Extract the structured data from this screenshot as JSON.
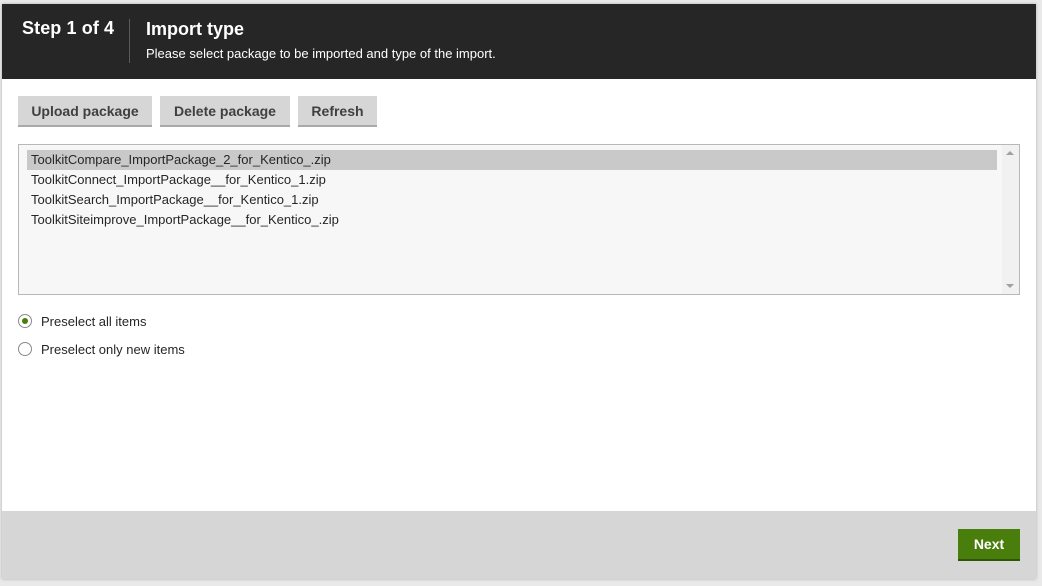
{
  "header": {
    "step": "Step 1 of 4",
    "title": "Import type",
    "subtitle": "Please select package to be imported and type of the import."
  },
  "toolbar": {
    "upload_label": "Upload package",
    "delete_label": "Delete package",
    "refresh_label": "Refresh"
  },
  "packages": {
    "items": [
      "ToolkitCompare_ImportPackage_2_for_Kentico_.zip",
      "ToolkitConnect_ImportPackage__for_Kentico_1.zip",
      "ToolkitSearch_ImportPackage__for_Kentico_1.zip",
      "ToolkitSiteimprove_ImportPackage__for_Kentico_.zip"
    ],
    "selected_index": 0
  },
  "options": {
    "preselect_all": "Preselect all items",
    "preselect_new": "Preselect only new items",
    "selected": "preselect_all"
  },
  "footer": {
    "next_label": "Next"
  },
  "colors": {
    "header_bg": "#262626",
    "accent_green": "#497d0c",
    "footer_bg": "#d6d6d6"
  }
}
